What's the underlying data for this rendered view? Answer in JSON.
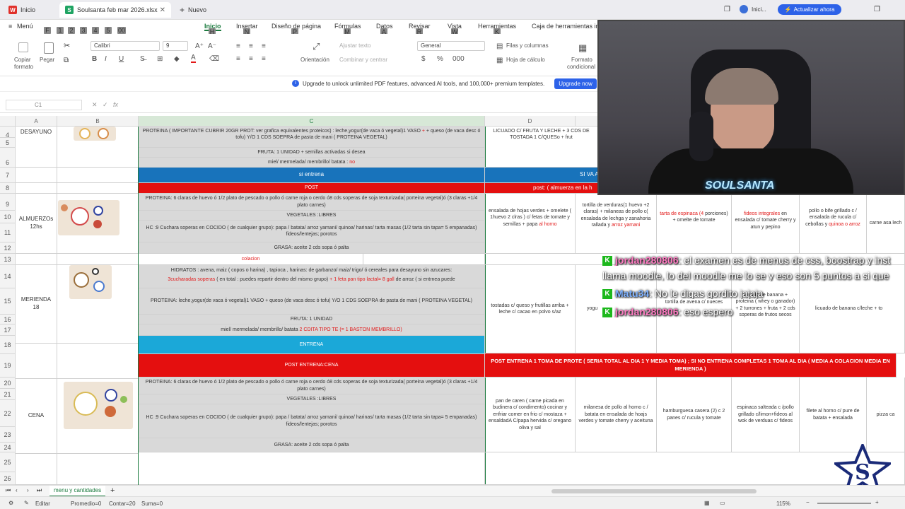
{
  "tabs": {
    "home": "Inicio",
    "file": "Soulsanta feb mar 2026.xlsx",
    "new": "Nuevo"
  },
  "titlebar": {
    "start": "Inici...",
    "upgrade": "Actualizar ahora"
  },
  "menu": {
    "menu": "Menú",
    "items": [
      "Inicio",
      "Insertar",
      "Diseño de página",
      "Fórmulas",
      "Datos",
      "Revisar",
      "Vista",
      "Herramientas",
      "Caja de herramientas im"
    ],
    "keys": [
      "H",
      "N",
      "P",
      "M",
      "A",
      "R",
      "W",
      "K"
    ],
    "left_keys": [
      "F",
      "1",
      "2",
      "3",
      "4",
      "5",
      "6",
      "00"
    ]
  },
  "ribbon": {
    "paste_copy": "Copiar",
    "paste_format": "formato",
    "paste": "Pegar",
    "font": "Calibri",
    "size": "9",
    "orientation": "Orientación",
    "wrap": "Ajustar texto",
    "merge": "Combinar y centrar",
    "number": "General",
    "rows": "Filas y columnas",
    "sheet": "Hoja de cálculo",
    "format1": "Formato",
    "format2": "condicional"
  },
  "notice": {
    "text": "Upgrade to unlock unlimited PDF features, advanced AI tools, and 100,000+ premium templates.",
    "button": "Upgrade now"
  },
  "formula": {
    "cellref": "C1",
    "fx": "fx"
  },
  "cols": [
    "A",
    "B",
    "C",
    "D"
  ],
  "rows": [
    "4",
    "5",
    "6",
    "7",
    "8",
    "9",
    "10",
    "11",
    "12",
    "13",
    "14",
    "15",
    "16",
    "17",
    "18",
    "19",
    "20",
    "21",
    "22",
    "23",
    "24",
    "25",
    "26"
  ],
  "sheet": {
    "desayuno": "DESAYUNO",
    "c_prot": "PROTEINA ( IMPORTANTE CUBRIR 20GR PROT: ver grafica equivalentes proteicos) : leche,yogur(de vaca ó vegetal)1 VASO",
    "c_prot2": "+ queso (de vaca desc ó tofu)  Y/O 1 CDS SOEPRA de pasta de mani ( PROTEINA VEGETAL)",
    "c_fruta": "FRUTA: 1 UNIDAD + semillas activadas si desea",
    "c_miel": "miel/ mermelada/ membrillo/ batata :",
    "c_no": "no",
    "si_entrena": "si entrena",
    "si_va": "SI VA A",
    "post": "POST",
    "post_d": "post: ( almuerza en la h",
    "d_top": "LICUADO C/ FRUTA Y LECHE + 3 CDS DE",
    "d_top2": "TOSTADA 1 C/QUESo + frut",
    "almuerzo": "ALMUERZOs 12hs",
    "c_prot_alm": "PROTEINA: 6 claras de huevo ó 1/2 plato de pescado o pollo ó carne roja o cerdo ó8 cds soperas de soja texturizada( porteina vegetal)ó (3 claras +1/4 plato carnes)",
    "c_veg": "VEGETALES :LIBRES",
    "c_hc": "HC :9 Cuchara soperas en COCIDO ( de cualquier grupo): papa / batata/ arroz yamani/ quinoa/ harinas/ tarta masas (1/2 tarta sin tapa= 5 empanadas) fideos/lentejas; porotos",
    "c_grasa": "GRASA: aceite 2 cds sopa ó palta",
    "alm_d": "ensalada de hojas verdes + omelete ( 1huevo 2 clras ) c/ fetas de tomate y semillas + papa",
    "alm_d2": "al horno",
    "alm_e": "tortilla de verduras(1 huevo +2 claras) + milaneas de pollo c( ensalada de lechga y zanahoria rallada y",
    "alm_e2": "arroz yamani",
    "alm_f1": "tarta de espinaca (4",
    "alm_f2": "porciones) + omelte de tomate",
    "alm_g1": "fideos integrales",
    "alm_g2": "en ensalada c/ tomate cherry y atun y pepino",
    "alm_h": "pollo o bife grillado c / ensalada de rucula c/ cebollas y",
    "alm_h2": "quinoa o arroz",
    "alm_i": "carne asa lech",
    "colacion": "colacion",
    "merienda": "MERIENDA 18",
    "c_hid": "HIDRATOS : avena, maiz ( copos o harina) , tapioca , harinas: de garbanzo/ maiz/ trigo/ ó cereales para desayuno sin azucares:",
    "c_hid2": "3cucharadas soperas",
    "c_hid3": "( en total : puedes repartir dentro del mismo grupo)",
    "c_hid4": "1 feta pan tipo lactal= 8 gall",
    "c_hid5": "de arroz ( si entrnea puede",
    "c_prot_mer": "PROTEINA: leche,yogur(de vaca ó vegetal)1 VASO  +  queso (de vaca desc ó tofu)  Y/O 1 CDS SOEPRA de pasta de mani ( PROTEINA VEGETAL)",
    "c_fruta2": "FRUTA: 1 UNIDAD",
    "c_miel2": "miel/ mermelada/ membrillo/ batata",
    "c_cdita": "2 CDITA TIPO TE (= 1 BASTON MEMBRILLO)",
    "mer_d": "tostadas c/ queso y frutillas arriba + leche c/ cacao en polvo s/az",
    "mer_e": "yogu",
    "mer_g": "whey o ganador) + 2 turrones + fruta + 2 cds soperas de frutos secos",
    "mer_g0": "licuado de banana + proteina (",
    "mer_h": "licuado de banana c/leche + to",
    "entrena": "ENTRENA",
    "post_entrena": "POST ENTRENA:CENA",
    "post_banner": "POST ENTRENA 1 TOMA DE PROTE ( SERIA TOTAL AL DIA 1 Y MEDIA TOMA) ; SI NO ENTRENA  COMPLETAS 1 TOMA AL DIA ( MEDIA A COLACION MEDIA EN MERIENDA )",
    "cena": "CENA",
    "cena_d": "pan de caren ( carne picada en budinera c/ condimento) cocinar y enfriar comer en frio c/ mostaza + ensaldadA C/papa hervida c/ oregano oliva y sal",
    "cena_e": "milanesa de pollo al horno c / batata en ensalada de hoajs verdes y tomate cherry y aceituna",
    "cena_f": "hamburguesa casera (2) c 2 panes c/ rucula y tomate",
    "cena_g": "espinaca salteada c /pollo grillado c/limon+fideos al wok de verduas c/  fideos",
    "cena_h": "filete al horno c/ pure de batata + ensalada",
    "cena_i": "pizza ca"
  },
  "chat": [
    {
      "user": "jordan280806",
      "msg": ": el examen es de menus de css, boostrap y inst"
    },
    {
      "user": "",
      "msg": "llama moodle, lo del moodle me lo se y eso son 5 puntos a si que"
    },
    {
      "user": "Matu34",
      "msg": ": No le digas gordito jajaja"
    },
    {
      "user": "jordan280806",
      "msg": ": eso espero"
    }
  ],
  "overlay_extra": "tortilla de avena c/ nueces",
  "overlay_extra2": "+ ban",
  "sheettab": "menu y cantidades",
  "status": {
    "edit": "Editar",
    "avg": "Promedio=0",
    "count": "Contar=20",
    "sum": "Suma=0",
    "zoom": "115%"
  },
  "colors": {
    "blue": "#1873bb",
    "red": "#e40f0f",
    "cyan": "#1ba8d8",
    "green": "#1db81d"
  }
}
